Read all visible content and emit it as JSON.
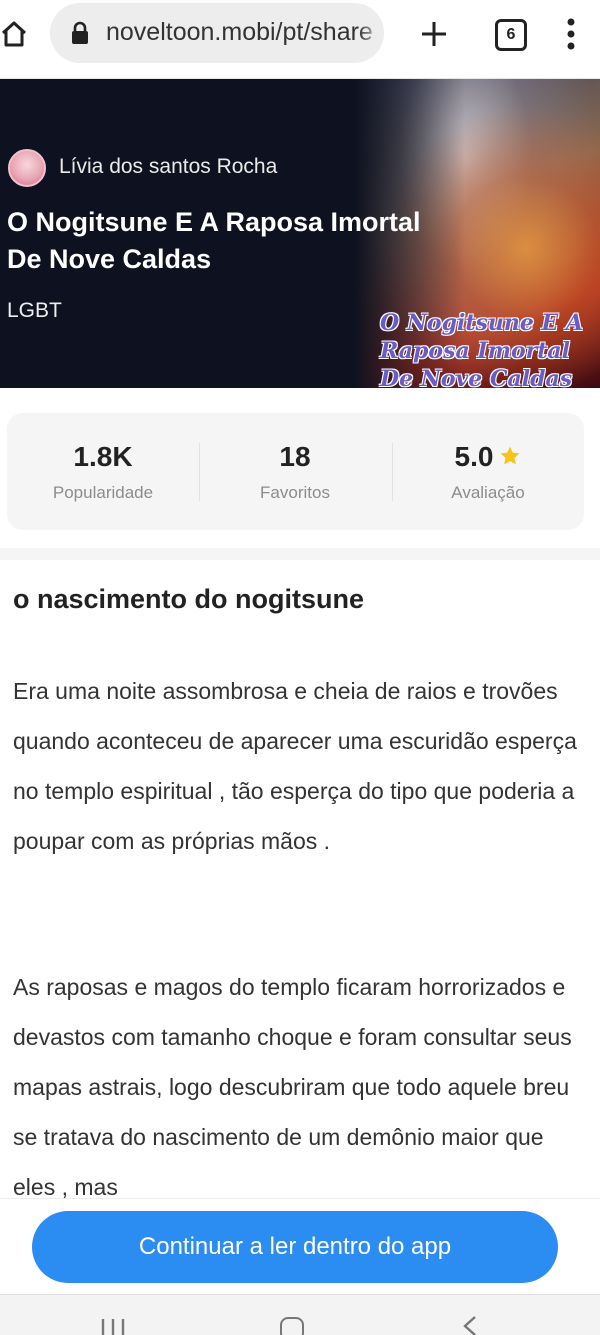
{
  "browser": {
    "url": "noveltoon.mobi/pt/share",
    "tab_count": "6"
  },
  "icons": {
    "home": "home-icon",
    "lock": "lock-icon",
    "plus": "plus-icon",
    "tabs": "tabs-icon",
    "menu": "more-vert-icon",
    "star": "star-icon"
  },
  "colors": {
    "hero_bg": "#0e1220",
    "accent": "#2b8cf2",
    "star": "#f7c31a"
  },
  "book": {
    "author": "Lívia dos santos Rocha",
    "title": "O Nogitsune E A Raposa Imortal De Nove Caldas",
    "genre": "LGBT",
    "cover_caption": "O Nogitsune E A Raposa Imortal De Nove Caldas"
  },
  "stats": [
    {
      "value": "1.8K",
      "label": "Popularidade"
    },
    {
      "value": "18",
      "label": "Favoritos"
    },
    {
      "value": "5.0",
      "label": "Avaliação"
    }
  ],
  "chapter": {
    "title": "o nascimento do nogitsune",
    "paragraphs": [
      "Era uma noite assombrosa e cheia de raios e trovões quando aconteceu de aparecer uma escuridão esperça no templo espiritual , tão esperça do tipo que poderia a poupar com as próprias mãos .",
      "As raposas e magos do templo ficaram horrorizados e devastos com tamanho choque e foram consultar seus mapas astrais, logo descubriram que todo aquele breu se tratava do nascimento de um demônio maior que eles , mas"
    ]
  },
  "cta": {
    "label": "Continuar a ler dentro do app"
  }
}
